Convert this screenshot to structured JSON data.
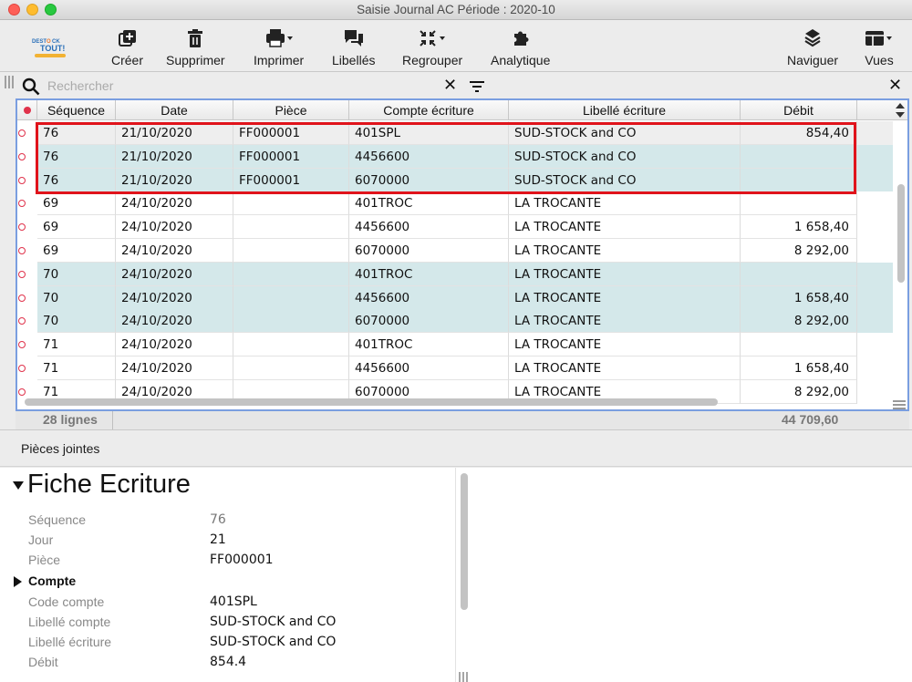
{
  "window": {
    "title": "Saisie Journal AC Période : 2020-10"
  },
  "toolbar": {
    "items": [
      {
        "label": "Créer",
        "icon": "plus-square-icon"
      },
      {
        "label": "Supprimer",
        "icon": "trash-icon"
      },
      {
        "label": "Imprimer",
        "icon": "printer-icon"
      },
      {
        "label": "Libellés",
        "icon": "chat-bubbles-icon"
      },
      {
        "label": "Regrouper",
        "icon": "collapse-arrows-icon"
      },
      {
        "label": "Analytique",
        "icon": "puzzle-icon"
      },
      {
        "label": "Naviguer",
        "icon": "layers-icon"
      },
      {
        "label": "Vues",
        "icon": "layout-icon"
      }
    ],
    "logo_text": "DESTOCK TOUT"
  },
  "search": {
    "placeholder": "Rechercher",
    "value": ""
  },
  "table": {
    "columns": [
      "Séquence",
      "Date",
      "Pièce",
      "Compte écriture",
      "Libellé écriture",
      "Débit"
    ],
    "rows": [
      {
        "seq": "76",
        "date": "21/10/2020",
        "piece": "FF000001",
        "compte": "401SPL",
        "libelle": "SUD-STOCK and CO",
        "debit": "854,40",
        "shade": "selected"
      },
      {
        "seq": "76",
        "date": "21/10/2020",
        "piece": "FF000001",
        "compte": "4456600",
        "libelle": "SUD-STOCK and CO",
        "debit": "",
        "shade": "teal"
      },
      {
        "seq": "76",
        "date": "21/10/2020",
        "piece": "FF000001",
        "compte": "6070000",
        "libelle": "SUD-STOCK and CO",
        "debit": "",
        "shade": "teal"
      },
      {
        "seq": "69",
        "date": "24/10/2020",
        "piece": "",
        "compte": "401TROC",
        "libelle": "LA TROCANTE",
        "debit": "",
        "shade": "white"
      },
      {
        "seq": "69",
        "date": "24/10/2020",
        "piece": "",
        "compte": "4456600",
        "libelle": "LA TROCANTE",
        "debit": "1 658,40",
        "shade": "white"
      },
      {
        "seq": "69",
        "date": "24/10/2020",
        "piece": "",
        "compte": "6070000",
        "libelle": "LA TROCANTE",
        "debit": "8 292,00",
        "shade": "white"
      },
      {
        "seq": "70",
        "date": "24/10/2020",
        "piece": "",
        "compte": "401TROC",
        "libelle": "LA TROCANTE",
        "debit": "",
        "shade": "teal"
      },
      {
        "seq": "70",
        "date": "24/10/2020",
        "piece": "",
        "compte": "4456600",
        "libelle": "LA TROCANTE",
        "debit": "1 658,40",
        "shade": "teal"
      },
      {
        "seq": "70",
        "date": "24/10/2020",
        "piece": "",
        "compte": "6070000",
        "libelle": "LA TROCANTE",
        "debit": "8 292,00",
        "shade": "teal"
      },
      {
        "seq": "71",
        "date": "24/10/2020",
        "piece": "",
        "compte": "401TROC",
        "libelle": "LA TROCANTE",
        "debit": "",
        "shade": "white"
      },
      {
        "seq": "71",
        "date": "24/10/2020",
        "piece": "",
        "compte": "4456600",
        "libelle": "LA TROCANTE",
        "debit": "1 658,40",
        "shade": "white"
      },
      {
        "seq": "71",
        "date": "24/10/2020",
        "piece": "",
        "compte": "6070000",
        "libelle": "LA TROCANTE",
        "debit": "8 292,00",
        "shade": "white"
      }
    ],
    "footer": {
      "count": "28 lignes",
      "total": "44 709,60"
    }
  },
  "attachments": {
    "label": "Pièces jointes"
  },
  "fiche": {
    "title": "Fiche Ecriture",
    "fields": [
      {
        "label": "Séquence",
        "value": "76",
        "muted": true
      },
      {
        "label": "Jour",
        "value": "21"
      },
      {
        "label": "Pièce",
        "value": "FF000001"
      }
    ],
    "section": "Compte",
    "section_fields": [
      {
        "label": "Code compte",
        "value": "401SPL"
      },
      {
        "label": "Libellé compte",
        "value": "SUD-STOCK and CO"
      },
      {
        "label": "Libellé écriture",
        "value": "SUD-STOCK and CO"
      },
      {
        "label": "Débit",
        "value": "854.4"
      }
    ]
  },
  "colors": {
    "selection_row": "#eeeeee",
    "teal_row": "#d4e8ea",
    "frame": "#7a9ee0",
    "highlight": "#e0131b",
    "row_marker": "#e0324b"
  }
}
